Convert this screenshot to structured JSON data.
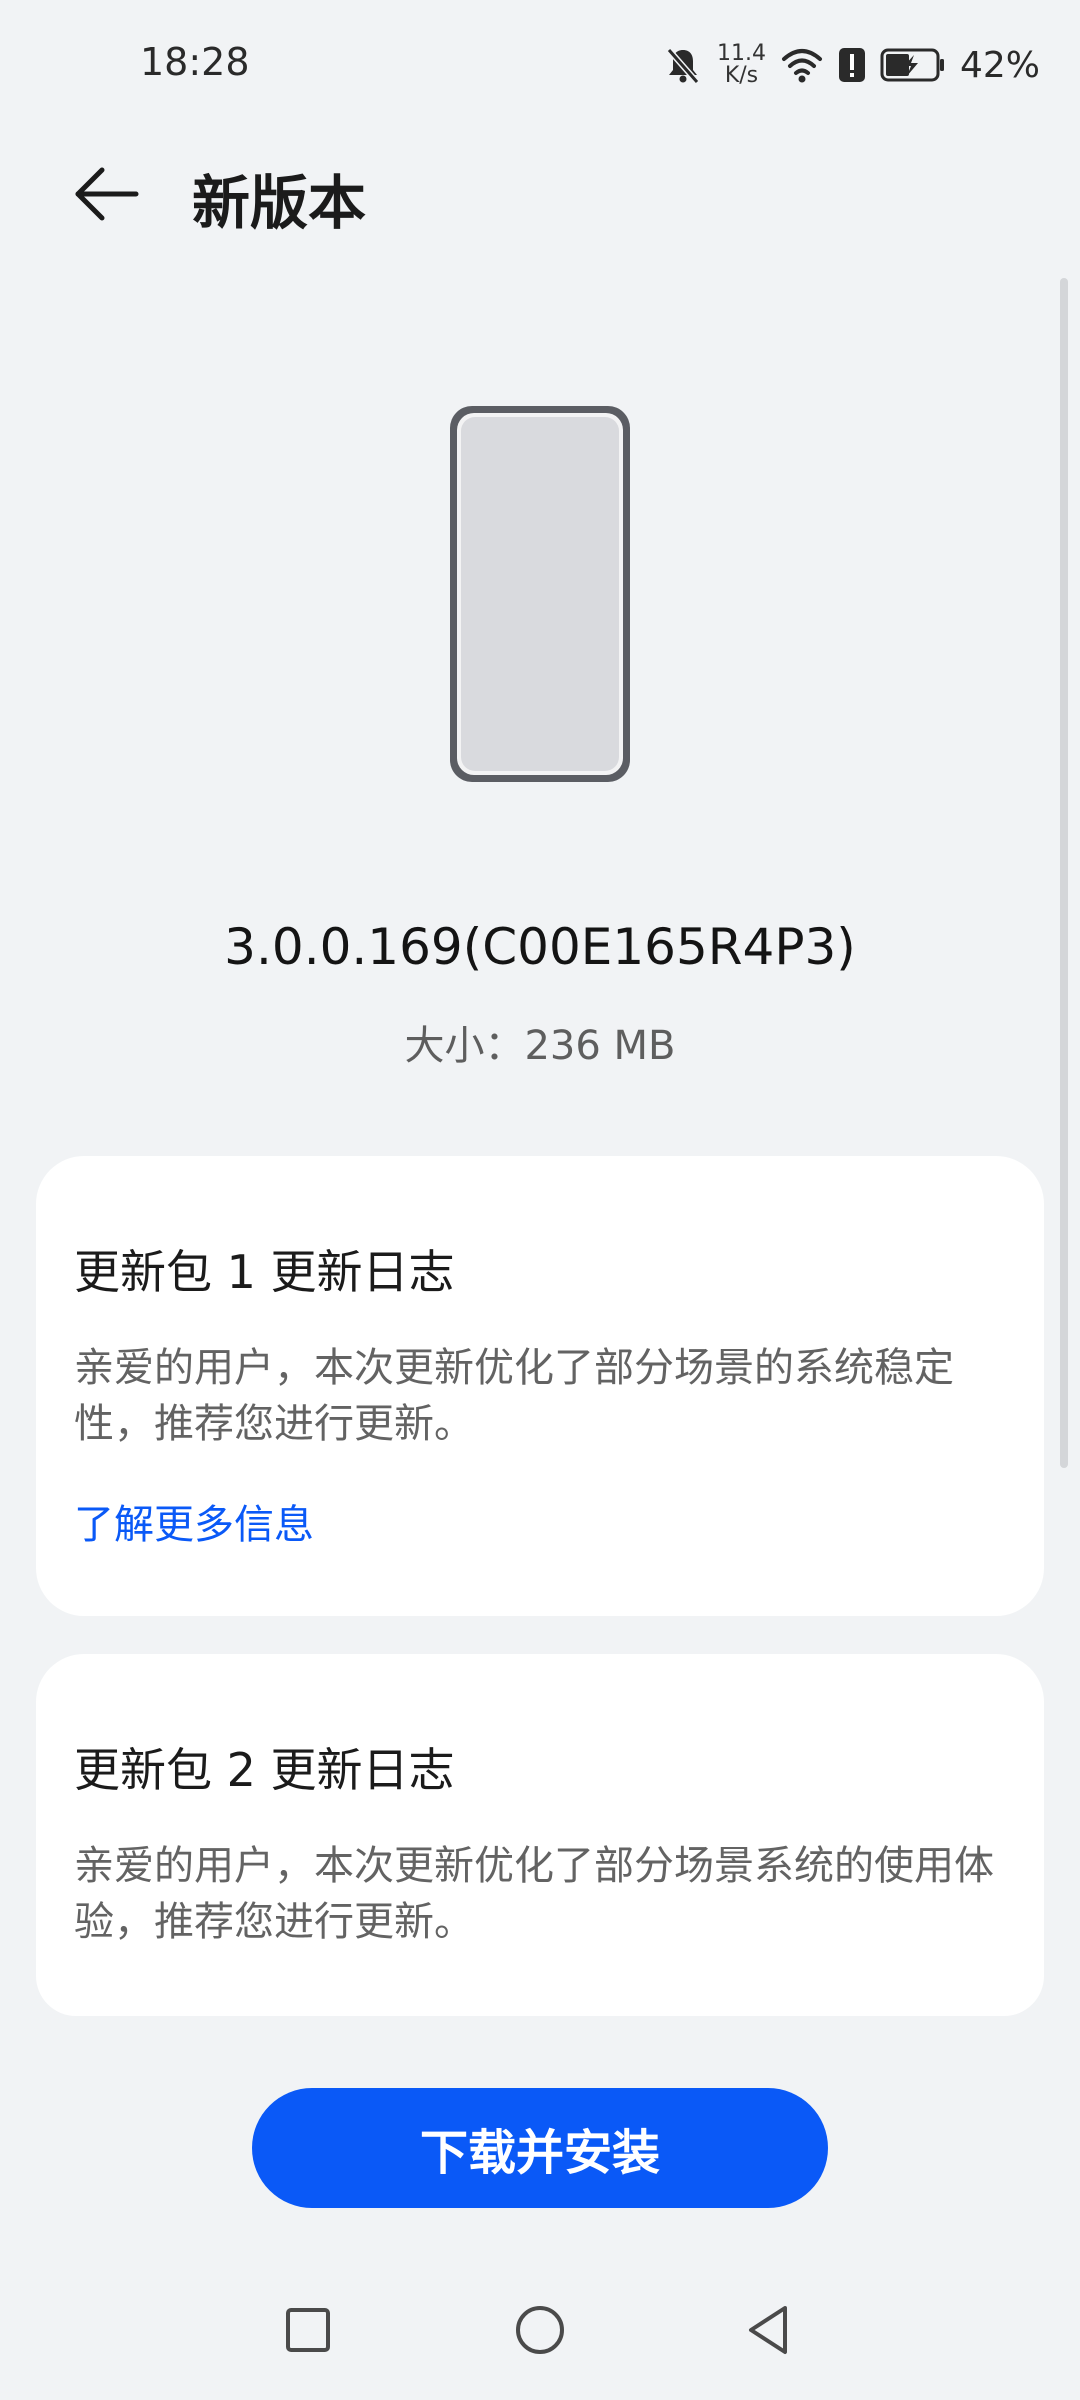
{
  "status_bar": {
    "time": "18:28",
    "net_speed_value": "11.4",
    "net_speed_unit": "K/s",
    "battery_percent": "42%",
    "icons": [
      "bell-muted-icon",
      "net-speed",
      "wifi-icon",
      "alert-icon",
      "battery-charging-icon"
    ]
  },
  "header": {
    "title": "新版本",
    "back_icon": "back-arrow-icon"
  },
  "update": {
    "version": "3.0.0.169(C00E165R4P3)",
    "size_label": "大小：236 MB",
    "illustration_icon": "phone-icon"
  },
  "changelogs": [
    {
      "title": "更新包 1 更新日志",
      "body": "亲爱的用户，本次更新优化了部分场景的系统稳定性，推荐您进行更新。",
      "link": "了解更多信息"
    },
    {
      "title": "更新包 2 更新日志",
      "body": "亲爱的用户，本次更新优化了部分场景系统的使用体验，推荐您进行更新。"
    }
  ],
  "actions": {
    "primary_label": "下载并安装"
  },
  "colors": {
    "background": "#f1f3f5",
    "card": "#ffffff",
    "accent": "#0a59f7",
    "body_text": "#636363"
  },
  "nav_bar": {
    "icons": [
      "recent-apps-icon",
      "home-icon",
      "back-icon"
    ]
  }
}
